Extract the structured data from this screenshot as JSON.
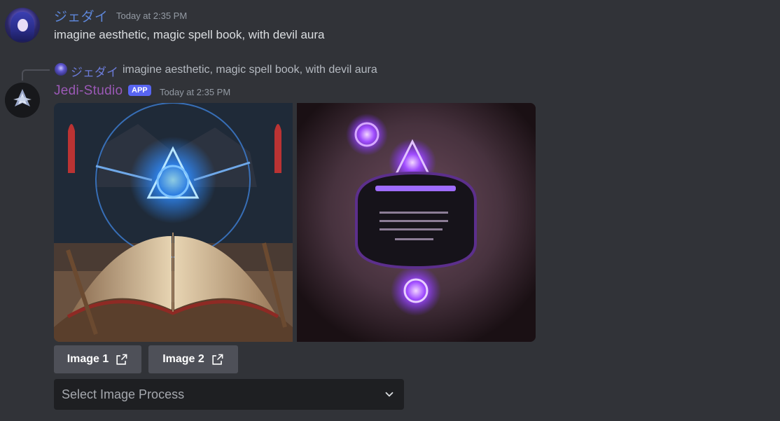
{
  "user_message": {
    "username": "ジェダイ",
    "username_color": "#5d86d8",
    "timestamp": "Today at 2:35 PM",
    "text": "imagine aesthetic, magic spell book, with devil aura"
  },
  "bot_message": {
    "reply": {
      "username": "ジェダイ",
      "text": "imagine aesthetic, magic spell book, with devil aura"
    },
    "username": "Jedi-Studio",
    "username_color": "#9b59b6",
    "badge": "APP",
    "timestamp": "Today at 2:35 PM",
    "images": [
      {
        "alt": "magic spell book with glowing blue sigil"
      },
      {
        "alt": "dark purple spell page with glowing purple runes"
      }
    ],
    "buttons": [
      {
        "label": "Image 1",
        "icon": "external-link-icon"
      },
      {
        "label": "Image 2",
        "icon": "external-link-icon"
      }
    ],
    "select": {
      "placeholder": "Select Image Process",
      "icon": "chevron-down-icon"
    }
  }
}
